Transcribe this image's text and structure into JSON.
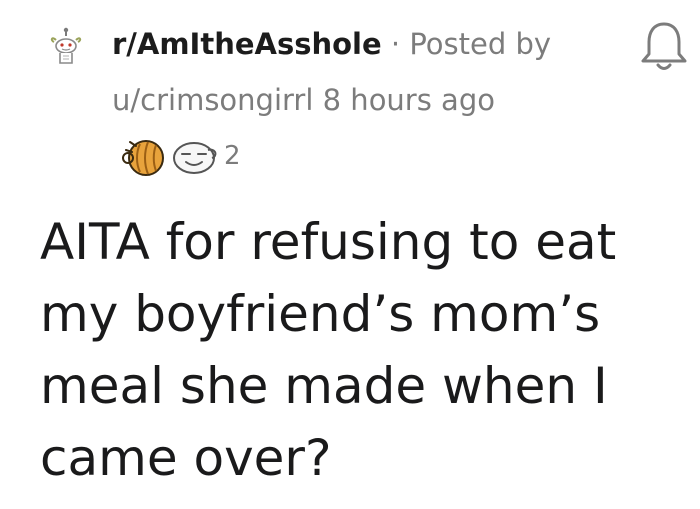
{
  "post": {
    "subreddit": "r/AmItheAsshole",
    "separator": "·",
    "posted_by_label": "Posted by",
    "author": "u/crimsongirrl",
    "time_ago": "8 hours ago",
    "award_count": "2",
    "title": "AITA for refusing to eat my boyfriend’s mom’s meal she made when I came over?"
  },
  "icons": {
    "subreddit": "subreddit-snoo-icon",
    "notifications": "bell-icon",
    "award_1": "award-coin-icon",
    "award_2": "award-face-icon"
  },
  "colors": {
    "text_primary": "#1c1c1c",
    "text_secondary": "#7c7c7c",
    "award_gold": "#e8a33c"
  }
}
